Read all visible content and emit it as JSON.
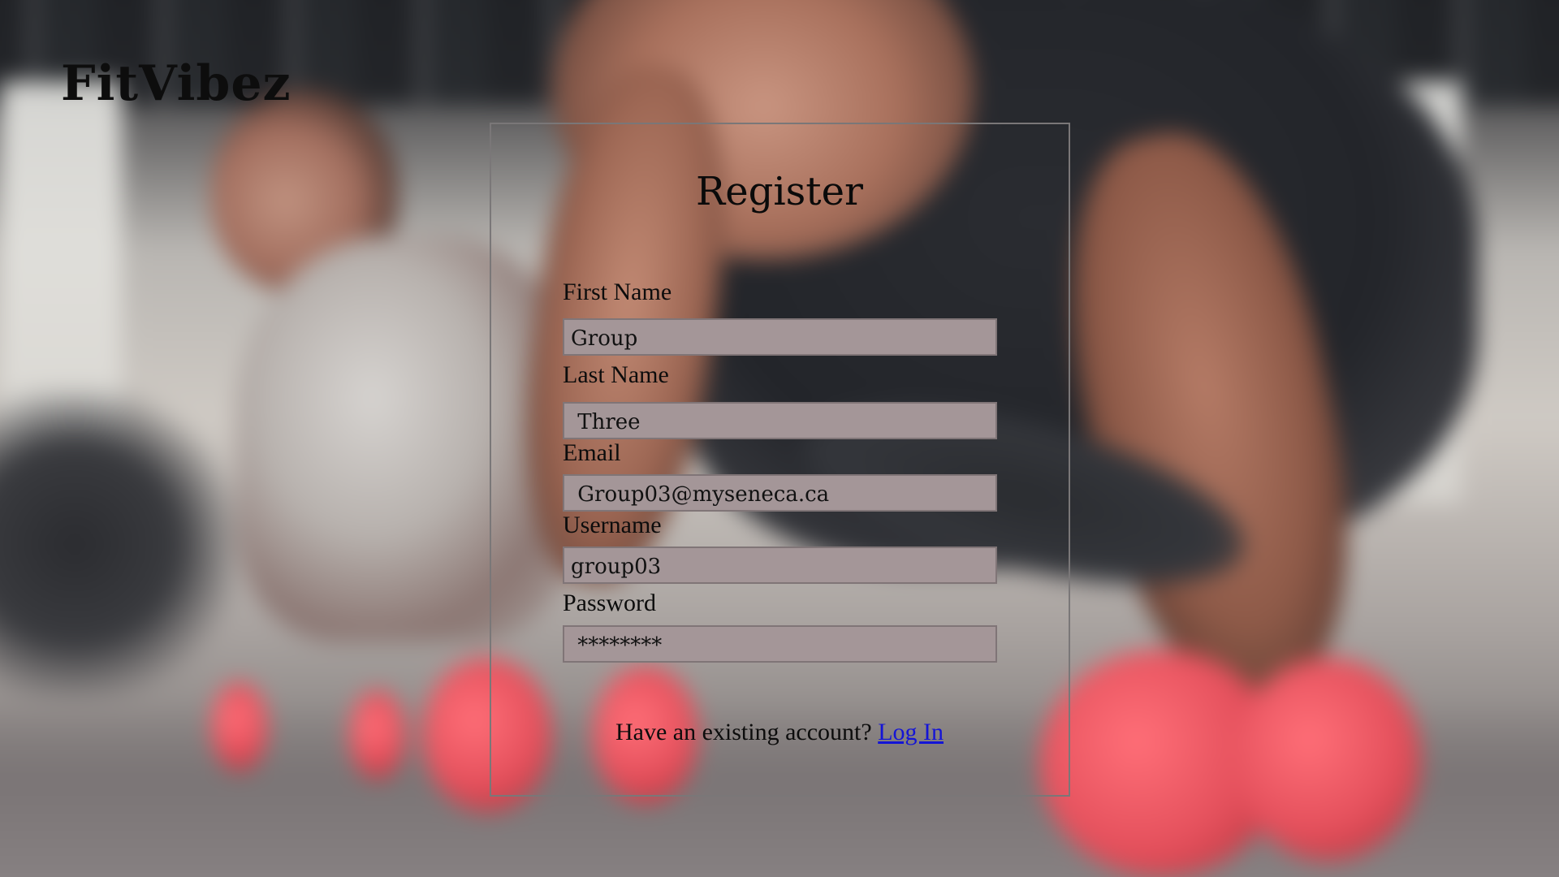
{
  "brand": "FitVibez",
  "form": {
    "title": "Register",
    "fields": [
      {
        "label": "First Name",
        "value": "Group"
      },
      {
        "label": "Last Name",
        "value": " Three"
      },
      {
        "label": "Email",
        "value": " Group03@myseneca.ca"
      },
      {
        "label": "Username",
        "value": "group03"
      },
      {
        "label": "Password",
        "value": " ********"
      }
    ],
    "existing_account_text": "Have an existing account?",
    "login_link": "Log In"
  },
  "colors": {
    "input_background": "#a49698",
    "link": "#1414d6",
    "text": "#0c0c0c"
  }
}
